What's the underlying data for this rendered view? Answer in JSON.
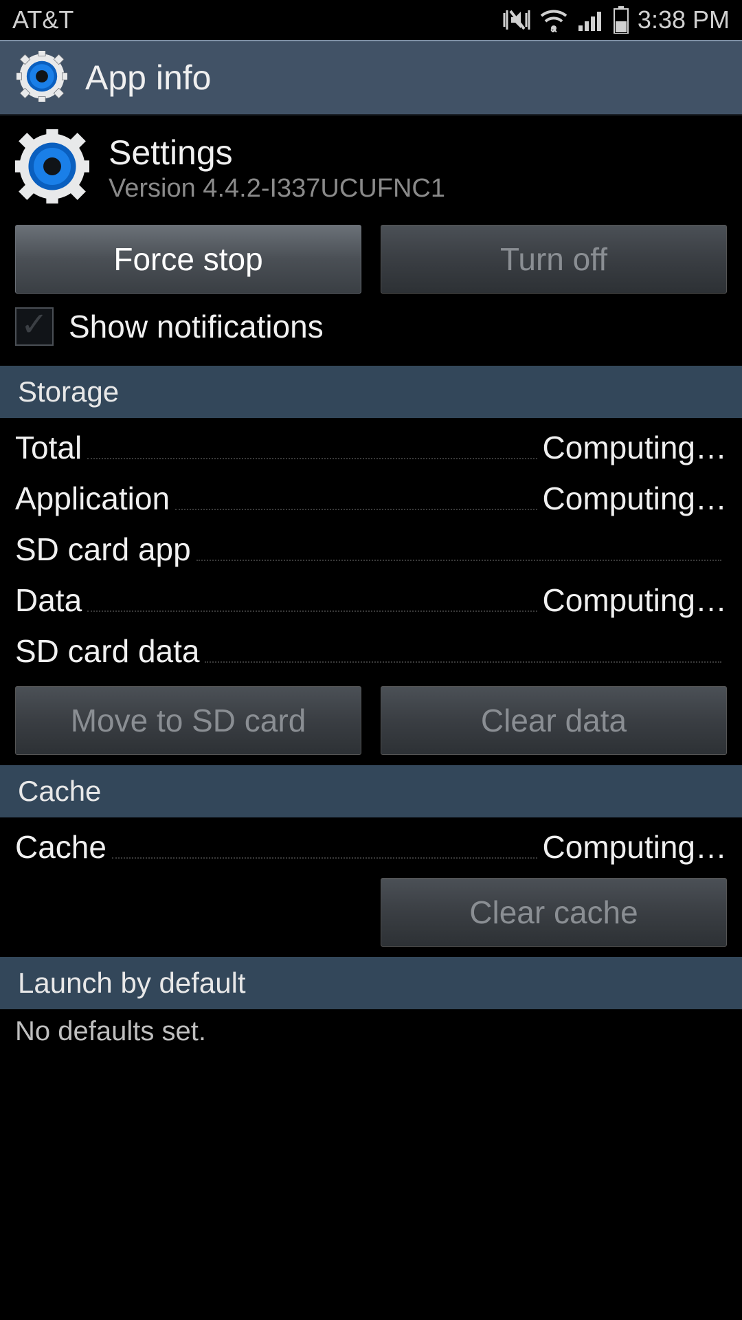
{
  "status_bar": {
    "carrier": "AT&T",
    "time": "3:38 PM"
  },
  "header": {
    "title": "App info"
  },
  "app": {
    "name": "Settings",
    "version": "Version 4.4.2-I337UCUFNC1"
  },
  "buttons": {
    "force_stop": "Force stop",
    "turn_off": "Turn off",
    "move_sd": "Move to SD card",
    "clear_data": "Clear data",
    "clear_cache": "Clear cache"
  },
  "checkbox": {
    "show_notifications": "Show notifications"
  },
  "sections": {
    "storage": "Storage",
    "cache": "Cache",
    "launch": "Launch by default"
  },
  "storage_rows": {
    "total_label": "Total",
    "total_value": "Computing…",
    "app_label": "Application",
    "app_value": "Computing…",
    "sdapp_label": "SD card app",
    "sdapp_value": "",
    "data_label": "Data",
    "data_value": "Computing…",
    "sddata_label": "SD card data",
    "sddata_value": ""
  },
  "cache_rows": {
    "cache_label": "Cache",
    "cache_value": "Computing…"
  },
  "defaults": {
    "text": "No defaults set."
  }
}
